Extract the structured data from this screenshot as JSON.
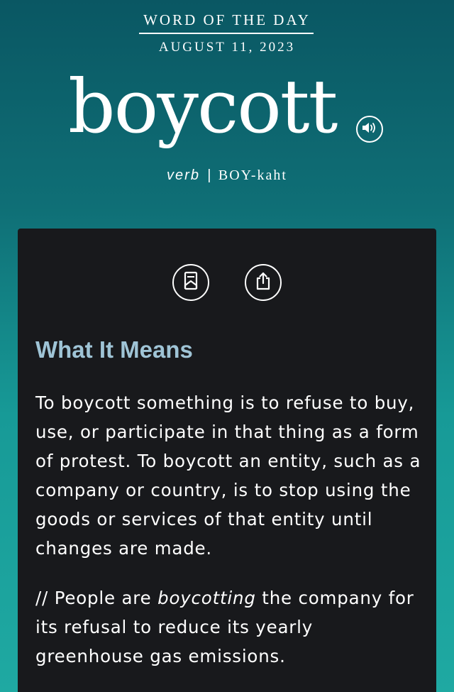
{
  "header": {
    "title": "WORD OF THE DAY",
    "date": "AUGUST 11, 2023",
    "word": "boycott",
    "part_of_speech": "verb",
    "separator": "|",
    "pronunciation": "BOY-kaht"
  },
  "icons": {
    "audio": "speaker-icon",
    "bookmark": "bookmark-icon",
    "share": "share-icon"
  },
  "colors": {
    "gradient_top": "#0a5763",
    "gradient_bottom": "#1fa9a2",
    "card_background": "#18191c",
    "heading_accent": "#9fc4d6",
    "text": "#ffffff"
  },
  "content": {
    "section_heading": "What It Means",
    "definition": "To boycott something is to refuse to buy, use, or participate in that thing as a form of protest. To boycott an entity, such as a company or country, is to stop using the goods or services of that entity until changes are made.",
    "example_prefix": "// People are ",
    "example_emphasis": "boycotting",
    "example_suffix": " the company for its refusal to reduce its yearly greenhouse gas emissions."
  }
}
